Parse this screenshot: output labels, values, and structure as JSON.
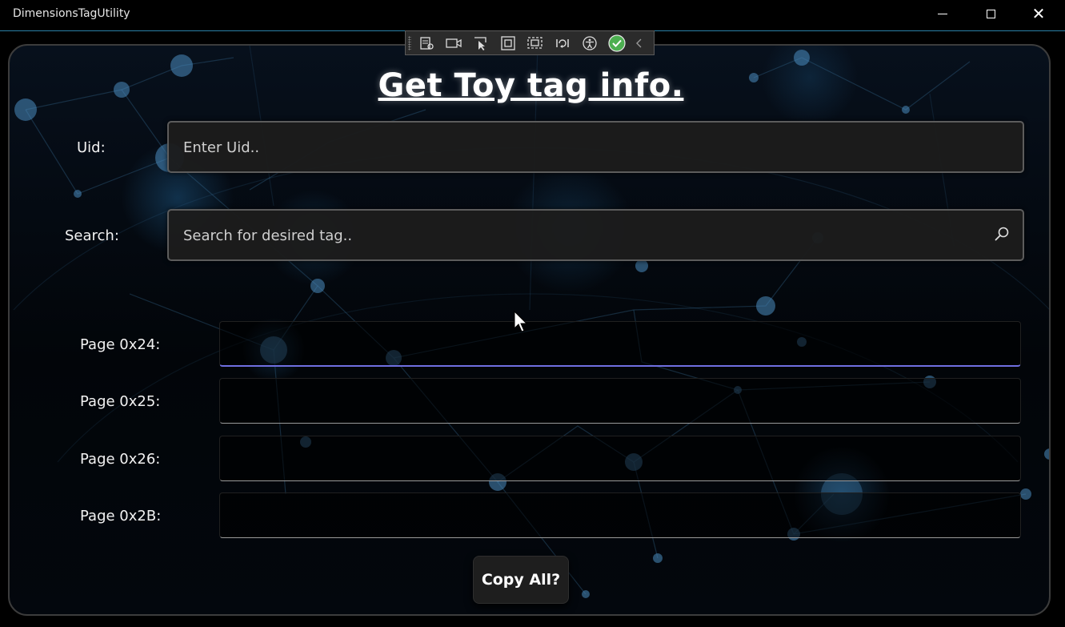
{
  "window": {
    "title": "DimensionsTagUtility",
    "controls": {
      "minimize": "minimize-icon",
      "maximize": "maximize-icon",
      "close": "✕"
    }
  },
  "debug_toolbar": {
    "tools": [
      "live-visual-tree-icon",
      "record-icon",
      "select-element-icon",
      "display-layout-adorners-icon",
      "track-focus-icon",
      "hot-reload-icon",
      "accessibility-icon",
      "binding-success-icon",
      "collapse-chevron-icon"
    ]
  },
  "main": {
    "heading": "Get Toy tag info.",
    "uid": {
      "label": "Uid:",
      "placeholder": "Enter Uid..",
      "value": ""
    },
    "search": {
      "label": "Search:",
      "placeholder": "Search for desired tag..",
      "value": ""
    },
    "pages": [
      {
        "label": "Page 0x24:",
        "value": ""
      },
      {
        "label": "Page 0x25:",
        "value": ""
      },
      {
        "label": "Page 0x26:",
        "value": ""
      },
      {
        "label": "Page 0x2B:",
        "value": ""
      }
    ],
    "copy_button": "Copy All?"
  },
  "colors": {
    "focus_underline": "#6f6fe0",
    "titlebar_border": "#2a7fa6",
    "background": "#03070d"
  }
}
